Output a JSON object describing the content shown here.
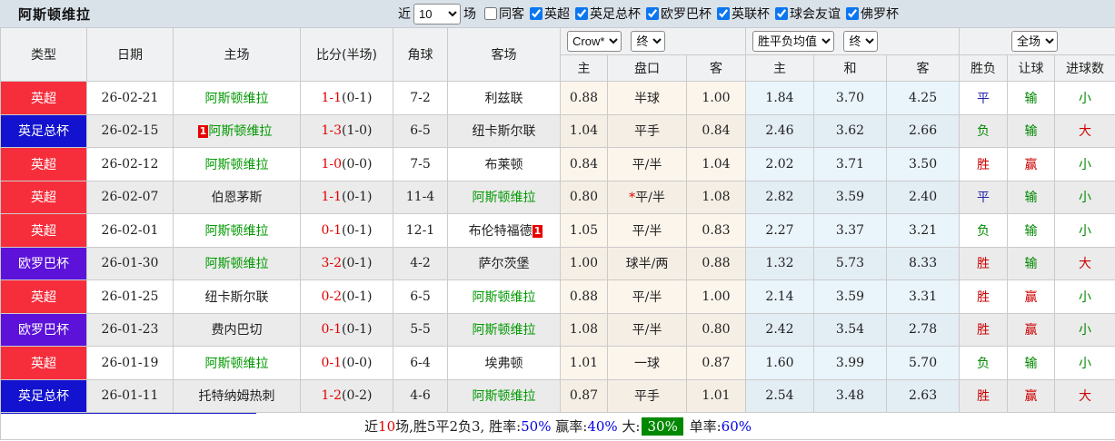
{
  "colors": {
    "topbar_bg": "#d9e1e9",
    "header_bg": "#f0f1f2",
    "row_alt_bg": "#ebebeb",
    "crow_cols_bg": "#fcf5ec",
    "avg_cols_bg": "#eaf4fb",
    "type_premier_league": "#f62e3c",
    "type_fa_cup": "#1212cf",
    "type_europa": "#5c12d9",
    "team_highlight_green": "#009900",
    "score_red": "#e60000",
    "result_win_red": "#cc0000",
    "result_draw_blue": "#2222aa",
    "result_lose_green": "#008800",
    "footer_percent_blue": "#0000e0",
    "footer_chip_green": "#008800",
    "bottom_accent_line": "#1a1acc"
  },
  "topbar": {
    "title": "阿斯顿维拉",
    "near_label": "近",
    "count_value": "10",
    "games_label": "场",
    "same_away": {
      "label": "同客",
      "checked": false
    },
    "league_filters": [
      {
        "label": "英超",
        "checked": true
      },
      {
        "label": "英足总杯",
        "checked": true
      },
      {
        "label": "欧罗巴杯",
        "checked": true
      },
      {
        "label": "英联杯",
        "checked": true
      },
      {
        "label": "球会友谊",
        "checked": true
      },
      {
        "label": "佛罗杯",
        "checked": true
      }
    ]
  },
  "table": {
    "selects": {
      "odds_company": "Crow*",
      "odds_stage": "终",
      "avg_type": "胜平负均值",
      "avg_stage": "终",
      "scope": "全场"
    },
    "main_headers": [
      "类型",
      "日期",
      "主场",
      "比分(半场)",
      "角球",
      "客场"
    ],
    "crow_subheaders": [
      "主",
      "盘口",
      "客"
    ],
    "avg_subheaders": [
      "主",
      "和",
      "客"
    ],
    "result_subheaders": [
      "胜负",
      "让球",
      "进球数"
    ],
    "rows": [
      {
        "type": {
          "label": "英超",
          "bg": "#f62e3c"
        },
        "date": "26-02-21",
        "home": {
          "text": "阿斯顿维拉",
          "green": true
        },
        "score": {
          "full": "1-1",
          "half": "(0-1)"
        },
        "corners": "7-2",
        "away": {
          "text": "利兹联",
          "green": false
        },
        "crow": {
          "home": "0.88",
          "handicap": "半球",
          "star": false,
          "away": "1.00"
        },
        "avg": {
          "home": "1.84",
          "draw": "3.70",
          "away": "4.25"
        },
        "results": [
          {
            "text": "平",
            "color": "#2222aa"
          },
          {
            "text": "输",
            "color": "#008800"
          },
          {
            "text": "小",
            "color": "#008800"
          }
        ]
      },
      {
        "type": {
          "label": "英足总杯",
          "bg": "#1212cf"
        },
        "date": "26-02-15",
        "home": {
          "text": "阿斯顿维拉",
          "green": true,
          "badge_before": "1"
        },
        "score": {
          "full": "1-3",
          "half": "(1-0)"
        },
        "corners": "6-5",
        "away": {
          "text": "纽卡斯尔联",
          "green": false
        },
        "crow": {
          "home": "1.04",
          "handicap": "平手",
          "star": false,
          "away": "0.84"
        },
        "avg": {
          "home": "2.46",
          "draw": "3.62",
          "away": "2.66"
        },
        "results": [
          {
            "text": "负",
            "color": "#008800"
          },
          {
            "text": "输",
            "color": "#008800"
          },
          {
            "text": "大",
            "color": "#cc0000"
          }
        ]
      },
      {
        "type": {
          "label": "英超",
          "bg": "#f62e3c"
        },
        "date": "26-02-12",
        "home": {
          "text": "阿斯顿维拉",
          "green": true
        },
        "score": {
          "full": "1-0",
          "half": "(0-0)"
        },
        "corners": "7-5",
        "away": {
          "text": "布莱顿",
          "green": false
        },
        "crow": {
          "home": "0.84",
          "handicap": "平/半",
          "star": false,
          "away": "1.04"
        },
        "avg": {
          "home": "2.02",
          "draw": "3.71",
          "away": "3.50"
        },
        "results": [
          {
            "text": "胜",
            "color": "#cc0000"
          },
          {
            "text": "赢",
            "color": "#cc0000"
          },
          {
            "text": "小",
            "color": "#008800"
          }
        ]
      },
      {
        "type": {
          "label": "英超",
          "bg": "#f62e3c"
        },
        "date": "26-02-07",
        "home": {
          "text": "伯恩茅斯",
          "green": false
        },
        "score": {
          "full": "1-1",
          "half": "(0-1)"
        },
        "corners": "11-4",
        "away": {
          "text": "阿斯顿维拉",
          "green": true
        },
        "crow": {
          "home": "0.80",
          "handicap": "平/半",
          "star": true,
          "away": "1.08"
        },
        "avg": {
          "home": "2.82",
          "draw": "3.59",
          "away": "2.40"
        },
        "results": [
          {
            "text": "平",
            "color": "#2222aa"
          },
          {
            "text": "输",
            "color": "#008800"
          },
          {
            "text": "小",
            "color": "#008800"
          }
        ]
      },
      {
        "type": {
          "label": "英超",
          "bg": "#f62e3c"
        },
        "date": "26-02-01",
        "home": {
          "text": "阿斯顿维拉",
          "green": true
        },
        "score": {
          "full": "0-1",
          "half": "(0-1)"
        },
        "corners": "12-1",
        "away": {
          "text": "布伦特福德",
          "green": false,
          "badge_after": "1"
        },
        "crow": {
          "home": "1.05",
          "handicap": "平/半",
          "star": false,
          "away": "0.83"
        },
        "avg": {
          "home": "2.27",
          "draw": "3.37",
          "away": "3.21"
        },
        "results": [
          {
            "text": "负",
            "color": "#008800"
          },
          {
            "text": "输",
            "color": "#008800"
          },
          {
            "text": "小",
            "color": "#008800"
          }
        ]
      },
      {
        "type": {
          "label": "欧罗巴杯",
          "bg": "#5c12d9"
        },
        "date": "26-01-30",
        "home": {
          "text": "阿斯顿维拉",
          "green": true
        },
        "score": {
          "full": "3-2",
          "half": "(0-1)"
        },
        "corners": "4-2",
        "away": {
          "text": "萨尔茨堡",
          "green": false
        },
        "crow": {
          "home": "1.00",
          "handicap": "球半/两",
          "star": false,
          "away": "0.88"
        },
        "avg": {
          "home": "1.32",
          "draw": "5.73",
          "away": "8.33"
        },
        "results": [
          {
            "text": "胜",
            "color": "#cc0000"
          },
          {
            "text": "输",
            "color": "#008800"
          },
          {
            "text": "大",
            "color": "#cc0000"
          }
        ]
      },
      {
        "type": {
          "label": "英超",
          "bg": "#f62e3c"
        },
        "date": "26-01-25",
        "home": {
          "text": "纽卡斯尔联",
          "green": false
        },
        "score": {
          "full": "0-2",
          "half": "(0-1)"
        },
        "corners": "6-5",
        "away": {
          "text": "阿斯顿维拉",
          "green": true
        },
        "crow": {
          "home": "0.88",
          "handicap": "平/半",
          "star": false,
          "away": "1.00"
        },
        "avg": {
          "home": "2.14",
          "draw": "3.59",
          "away": "3.31"
        },
        "results": [
          {
            "text": "胜",
            "color": "#cc0000"
          },
          {
            "text": "赢",
            "color": "#cc0000"
          },
          {
            "text": "小",
            "color": "#008800"
          }
        ]
      },
      {
        "type": {
          "label": "欧罗巴杯",
          "bg": "#5c12d9"
        },
        "date": "26-01-23",
        "home": {
          "text": "费内巴切",
          "green": false
        },
        "score": {
          "full": "0-1",
          "half": "(0-1)"
        },
        "corners": "5-5",
        "away": {
          "text": "阿斯顿维拉",
          "green": true
        },
        "crow": {
          "home": "1.08",
          "handicap": "平/半",
          "star": false,
          "away": "0.80"
        },
        "avg": {
          "home": "2.42",
          "draw": "3.54",
          "away": "2.78"
        },
        "results": [
          {
            "text": "胜",
            "color": "#cc0000"
          },
          {
            "text": "赢",
            "color": "#cc0000"
          },
          {
            "text": "小",
            "color": "#008800"
          }
        ]
      },
      {
        "type": {
          "label": "英超",
          "bg": "#f62e3c"
        },
        "date": "26-01-19",
        "home": {
          "text": "阿斯顿维拉",
          "green": true
        },
        "score": {
          "full": "0-1",
          "half": "(0-0)"
        },
        "corners": "6-4",
        "away": {
          "text": "埃弗顿",
          "green": false
        },
        "crow": {
          "home": "1.01",
          "handicap": "一球",
          "star": false,
          "away": "0.87"
        },
        "avg": {
          "home": "1.60",
          "draw": "3.99",
          "away": "5.70"
        },
        "results": [
          {
            "text": "负",
            "color": "#008800"
          },
          {
            "text": "输",
            "color": "#008800"
          },
          {
            "text": "小",
            "color": "#008800"
          }
        ]
      },
      {
        "type": {
          "label": "英足总杯",
          "bg": "#1212cf"
        },
        "date": "26-01-11",
        "home": {
          "text": "托特纳姆热刺",
          "green": false
        },
        "score": {
          "full": "1-2",
          "half": "(0-2)"
        },
        "corners": "4-6",
        "away": {
          "text": "阿斯顿维拉",
          "green": true
        },
        "crow": {
          "home": "0.87",
          "handicap": "平手",
          "star": false,
          "away": "1.01"
        },
        "avg": {
          "home": "2.54",
          "draw": "3.48",
          "away": "2.63"
        },
        "results": [
          {
            "text": "胜",
            "color": "#cc0000"
          },
          {
            "text": "赢",
            "color": "#cc0000"
          },
          {
            "text": "大",
            "color": "#cc0000"
          }
        ]
      }
    ]
  },
  "footer": {
    "prefix": "近",
    "count": "10",
    "mid": "场,胜5平2负3, ",
    "win_rate_label": "胜率:",
    "win_rate": "50%",
    "odds_win_label": " 赢率:",
    "odds_win": "40%",
    "big_label": " 大:",
    "big": "30%",
    "single_label": " 单率:",
    "single": "60%"
  }
}
